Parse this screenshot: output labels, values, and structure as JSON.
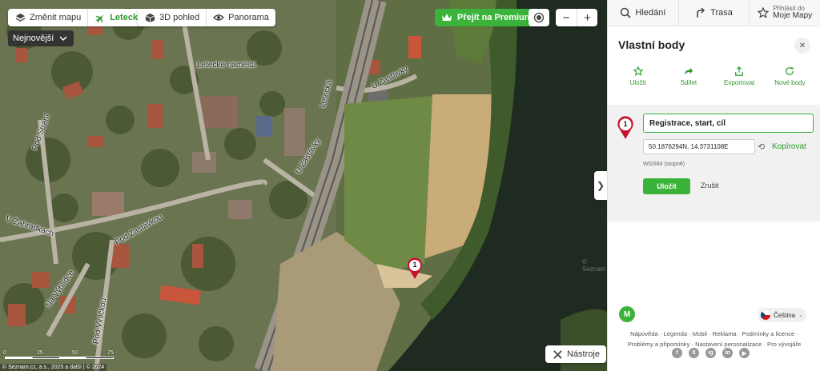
{
  "map_toolbar": {
    "change_map": "Změnit mapu",
    "aerial": "Letecká",
    "view_3d": "3D pohled",
    "panorama": "Panorama",
    "premium": "Přejít na Premium",
    "zoom_out": "−",
    "zoom_in": "+",
    "sort": "Nejnovější",
    "tools": "Nástroje",
    "collapse": "❯"
  },
  "map_labels": {
    "letecke_namesti": "Letecké náměstí",
    "letecka": "Letecká",
    "u_zastavky": "U Zastávky",
    "u_zastavky_2": "U Zastávky",
    "pod_strani": "Pod Strání",
    "v_zahradkach": "V Zahrádkách",
    "pod_zastavkou": "Pod Zastávkou",
    "na_vyhlidce": "Na Výhlídce",
    "pod_vinickou": "Pod Viničkou",
    "seznam": "© Seznam"
  },
  "marker": {
    "number": "1"
  },
  "scale": {
    "labels": [
      "0",
      "25",
      "50",
      "75"
    ]
  },
  "attribution": "© Seznam.cz, a.s., 2025 a další | © 2024",
  "top_nav": {
    "search": "Hledání",
    "route": "Trasa",
    "login_small": "Přihlásit do",
    "login_big": "Moje Mapy"
  },
  "panel": {
    "title": "Vlastní body",
    "actions": [
      {
        "label": "Uložit",
        "icon": "star-icon"
      },
      {
        "label": "Sdílet",
        "icon": "share-icon"
      },
      {
        "label": "Exportovat",
        "icon": "export-icon"
      },
      {
        "label": "Nové body",
        "icon": "refresh-icon"
      }
    ],
    "point": {
      "number": "1",
      "name": "Registrace, start, cíl",
      "coords": "50.1876294N, 14.3731108E",
      "copy": "Kopírovat",
      "coord_system": "WGS84 (stupně)",
      "save": "Uložit",
      "cancel": "Zrušit"
    }
  },
  "footer": {
    "logo": "M",
    "language": "Čeština",
    "links_line1": "Nápověda · Legenda · Mobil · Reklama · Podmínky a licence ·",
    "links_line2": "Problémy a připomínky · Nastavení personalizace · Pro vývojáře",
    "socials": [
      "f",
      "X",
      "ig",
      "in",
      "▶"
    ]
  },
  "colors": {
    "accent": "#3bb33b",
    "marker": "#c8102e"
  }
}
